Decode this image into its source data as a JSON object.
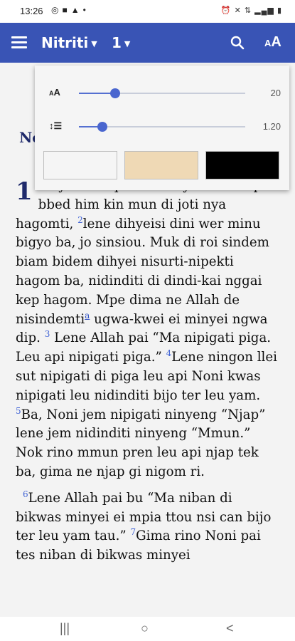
{
  "status_bar": {
    "time": "13:26",
    "icons_left": [
      "whatsapp-icon",
      "message-icon",
      "alert-icon",
      "dot-icon"
    ],
    "icons_right": [
      "alarm-icon",
      "mute-icon",
      "4g-signal-icon",
      "signal-icon",
      "signal-icon",
      "battery-icon"
    ]
  },
  "toolbar": {
    "book": "Nitriti",
    "chapter": "1",
    "text_size_small": "A",
    "text_size_large": "A"
  },
  "content": {
    "heading": "No",
    "chapter_number": "1",
    "para1_start": "kinyon ei nipai tes dihyeisi kin mpia-bbed him kin mun di joti nya hagomti,",
    "verse2": "2",
    "verse2_text": "lene dihyeisi dini wer minu bigyo ba, jo sinsiou. Muk di roi sindem biam bidem dihyei nisurti-nipekti hagom ba, nidinditi di dindi-kai nggai kep hagom. Mpe dima ne Allah de nisindemti",
    "footnote": "a",
    "verse2_text_end": "ugwa-kwei ei minyei ngwa dip.",
    "verse3": "3",
    "verse3_text": "Lene Allah pai “Ma nipigati piga. Leu api nipigati piga.”",
    "verse4": "4",
    "verse4_text": "Lene ningon llei sut nipigati di piga leu api Noni kwas nipigati leu nidinditi bijo ter leu yam.",
    "verse5": "5",
    "verse5_text": "Ba, Noni jem nipigati ninyeng “Njap” lene jem nidinditi ninyeng “Mmun.” Nok rino mmun pren leu api njap tek ba, gima ne njap gi nigom ri.",
    "verse6": "6",
    "verse6_text": "Lene Allah pai bu “Ma niban di bikwas minyei ei mpia ttou nsi can bijo ter leu yam tau.”",
    "verse7": "7",
    "verse7_text": "Gima rino Noni pai tes niban di bikwas minyei"
  },
  "settings_panel": {
    "font_size_label": "A",
    "font_size_value": "20",
    "font_size_level": 0.22,
    "line_spacing_value": "1.20",
    "line_spacing_level": 0.14,
    "themes": [
      {
        "name": "white",
        "color": "#f5f5f5"
      },
      {
        "name": "sepia",
        "color": "#efd9b5"
      },
      {
        "name": "black",
        "color": "#000000"
      }
    ]
  },
  "nav_bar": {
    "recents": "|||",
    "home": "○",
    "back": "<"
  },
  "colors": {
    "toolbar": "#3954b5",
    "accent": "#4a66cf",
    "verse_number": "#4466d6",
    "heading": "#1f2a6b"
  }
}
